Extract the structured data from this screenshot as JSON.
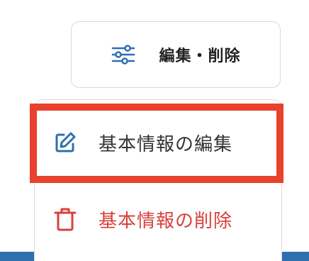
{
  "toggle": {
    "label": "編集・削除",
    "icon": "sliders-icon",
    "icon_color": "#2f6fae"
  },
  "menu": {
    "items": [
      {
        "label": "基本情報の編集",
        "icon": "edit-icon",
        "color": "#333333",
        "icon_color": "#2f6fae"
      },
      {
        "label": "基本情報の削除",
        "icon": "trash-icon",
        "color": "#d9403c",
        "icon_color": "#d9403c"
      }
    ]
  },
  "colors": {
    "highlight": "#e8412c",
    "accent": "#2f6fae"
  }
}
